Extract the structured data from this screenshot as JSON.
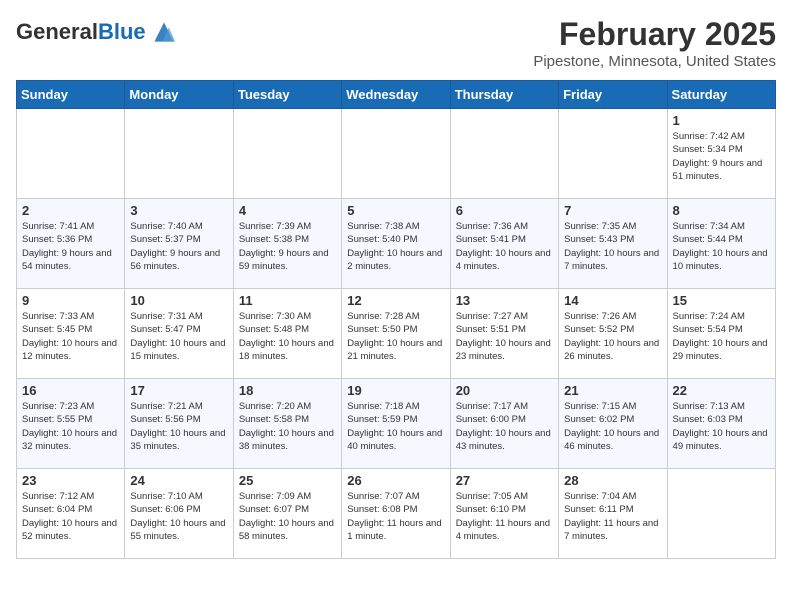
{
  "logo": {
    "general": "General",
    "blue": "Blue"
  },
  "title": "February 2025",
  "subtitle": "Pipestone, Minnesota, United States",
  "weekdays": [
    "Sunday",
    "Monday",
    "Tuesday",
    "Wednesday",
    "Thursday",
    "Friday",
    "Saturday"
  ],
  "weeks": [
    [
      {
        "day": "",
        "info": ""
      },
      {
        "day": "",
        "info": ""
      },
      {
        "day": "",
        "info": ""
      },
      {
        "day": "",
        "info": ""
      },
      {
        "day": "",
        "info": ""
      },
      {
        "day": "",
        "info": ""
      },
      {
        "day": "1",
        "info": "Sunrise: 7:42 AM\nSunset: 5:34 PM\nDaylight: 9 hours and 51 minutes."
      }
    ],
    [
      {
        "day": "2",
        "info": "Sunrise: 7:41 AM\nSunset: 5:36 PM\nDaylight: 9 hours and 54 minutes."
      },
      {
        "day": "3",
        "info": "Sunrise: 7:40 AM\nSunset: 5:37 PM\nDaylight: 9 hours and 56 minutes."
      },
      {
        "day": "4",
        "info": "Sunrise: 7:39 AM\nSunset: 5:38 PM\nDaylight: 9 hours and 59 minutes."
      },
      {
        "day": "5",
        "info": "Sunrise: 7:38 AM\nSunset: 5:40 PM\nDaylight: 10 hours and 2 minutes."
      },
      {
        "day": "6",
        "info": "Sunrise: 7:36 AM\nSunset: 5:41 PM\nDaylight: 10 hours and 4 minutes."
      },
      {
        "day": "7",
        "info": "Sunrise: 7:35 AM\nSunset: 5:43 PM\nDaylight: 10 hours and 7 minutes."
      },
      {
        "day": "8",
        "info": "Sunrise: 7:34 AM\nSunset: 5:44 PM\nDaylight: 10 hours and 10 minutes."
      }
    ],
    [
      {
        "day": "9",
        "info": "Sunrise: 7:33 AM\nSunset: 5:45 PM\nDaylight: 10 hours and 12 minutes."
      },
      {
        "day": "10",
        "info": "Sunrise: 7:31 AM\nSunset: 5:47 PM\nDaylight: 10 hours and 15 minutes."
      },
      {
        "day": "11",
        "info": "Sunrise: 7:30 AM\nSunset: 5:48 PM\nDaylight: 10 hours and 18 minutes."
      },
      {
        "day": "12",
        "info": "Sunrise: 7:28 AM\nSunset: 5:50 PM\nDaylight: 10 hours and 21 minutes."
      },
      {
        "day": "13",
        "info": "Sunrise: 7:27 AM\nSunset: 5:51 PM\nDaylight: 10 hours and 23 minutes."
      },
      {
        "day": "14",
        "info": "Sunrise: 7:26 AM\nSunset: 5:52 PM\nDaylight: 10 hours and 26 minutes."
      },
      {
        "day": "15",
        "info": "Sunrise: 7:24 AM\nSunset: 5:54 PM\nDaylight: 10 hours and 29 minutes."
      }
    ],
    [
      {
        "day": "16",
        "info": "Sunrise: 7:23 AM\nSunset: 5:55 PM\nDaylight: 10 hours and 32 minutes."
      },
      {
        "day": "17",
        "info": "Sunrise: 7:21 AM\nSunset: 5:56 PM\nDaylight: 10 hours and 35 minutes."
      },
      {
        "day": "18",
        "info": "Sunrise: 7:20 AM\nSunset: 5:58 PM\nDaylight: 10 hours and 38 minutes."
      },
      {
        "day": "19",
        "info": "Sunrise: 7:18 AM\nSunset: 5:59 PM\nDaylight: 10 hours and 40 minutes."
      },
      {
        "day": "20",
        "info": "Sunrise: 7:17 AM\nSunset: 6:00 PM\nDaylight: 10 hours and 43 minutes."
      },
      {
        "day": "21",
        "info": "Sunrise: 7:15 AM\nSunset: 6:02 PM\nDaylight: 10 hours and 46 minutes."
      },
      {
        "day": "22",
        "info": "Sunrise: 7:13 AM\nSunset: 6:03 PM\nDaylight: 10 hours and 49 minutes."
      }
    ],
    [
      {
        "day": "23",
        "info": "Sunrise: 7:12 AM\nSunset: 6:04 PM\nDaylight: 10 hours and 52 minutes."
      },
      {
        "day": "24",
        "info": "Sunrise: 7:10 AM\nSunset: 6:06 PM\nDaylight: 10 hours and 55 minutes."
      },
      {
        "day": "25",
        "info": "Sunrise: 7:09 AM\nSunset: 6:07 PM\nDaylight: 10 hours and 58 minutes."
      },
      {
        "day": "26",
        "info": "Sunrise: 7:07 AM\nSunset: 6:08 PM\nDaylight: 11 hours and 1 minute."
      },
      {
        "day": "27",
        "info": "Sunrise: 7:05 AM\nSunset: 6:10 PM\nDaylight: 11 hours and 4 minutes."
      },
      {
        "day": "28",
        "info": "Sunrise: 7:04 AM\nSunset: 6:11 PM\nDaylight: 11 hours and 7 minutes."
      },
      {
        "day": "",
        "info": ""
      }
    ]
  ]
}
